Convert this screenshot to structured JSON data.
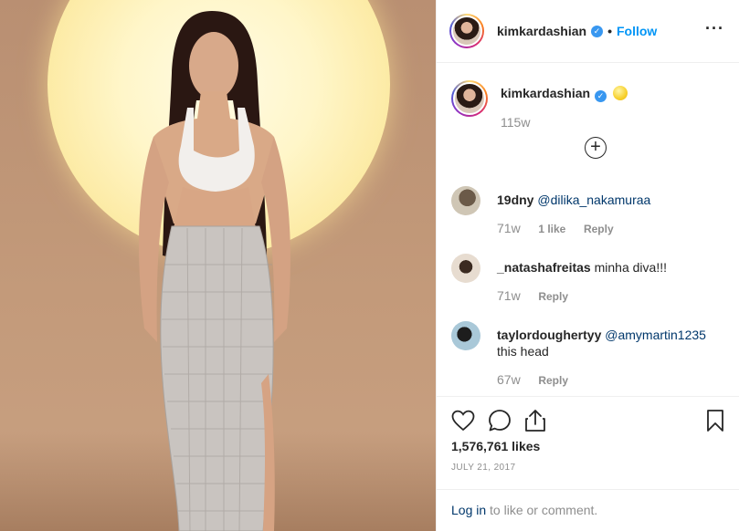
{
  "post": {
    "username": "kimkardashian",
    "verified_mark": "✓",
    "dot": "•",
    "follow_label": "Follow",
    "more_label": "···"
  },
  "caption": {
    "username": "kimkardashian",
    "emoji": "yellow-circle",
    "time": "115w"
  },
  "load_more_label": "+",
  "comments": [
    {
      "username": "19dny",
      "mention": "@dilika_nakamuraa",
      "text": "",
      "time": "71w",
      "likes": "1 like",
      "reply": "Reply"
    },
    {
      "username": "_natashafreitas",
      "mention": "",
      "text": "minha diva!!!",
      "time": "71w",
      "likes": "",
      "reply": "Reply"
    },
    {
      "username": "taylordoughertyy",
      "mention": "@amymartin1235",
      "text": "this head",
      "time": "67w",
      "likes": "",
      "reply": "Reply"
    }
  ],
  "actions": {
    "icons": [
      "heart-icon",
      "comment-icon",
      "share-icon",
      "bookmark-icon"
    ],
    "likes": "1,576,761 likes",
    "date": "JULY 21, 2017"
  },
  "login": {
    "link": "Log in",
    "rest": " to like or comment."
  },
  "colors": {
    "link_blue": "#0095f6",
    "mention_blue": "#00376b",
    "muted": "#8e8e8e",
    "border": "#efefef"
  }
}
